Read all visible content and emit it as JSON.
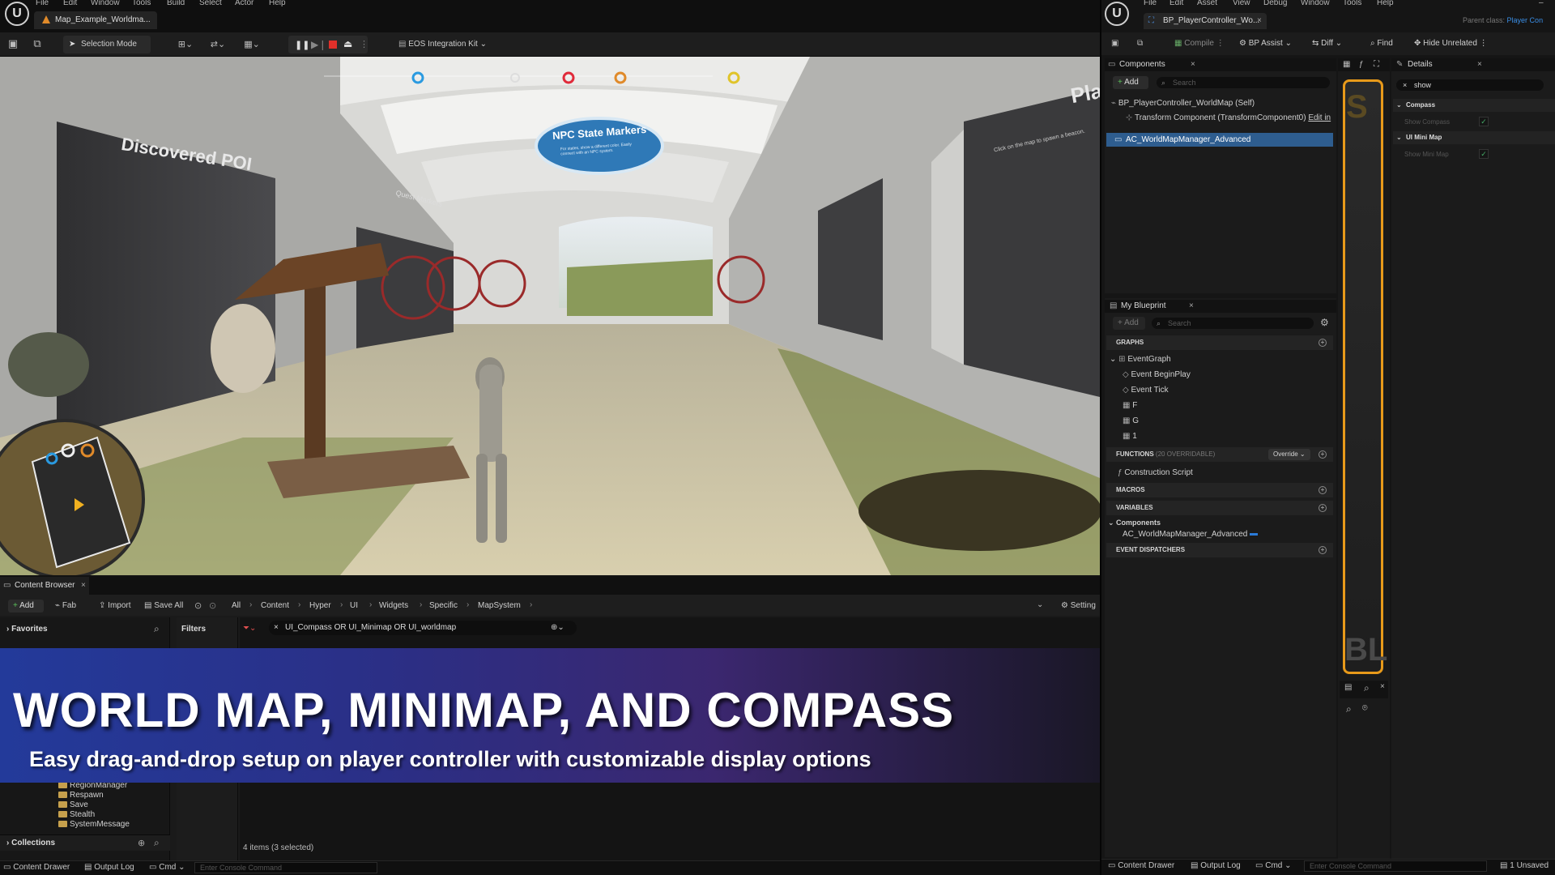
{
  "left_menu": [
    "File",
    "Edit",
    "Window",
    "Tools",
    "Build",
    "Select",
    "Actor",
    "Help"
  ],
  "left_doc_tab": "Map_Example_Worldma...",
  "left_toolbar": {
    "selection_mode": "Selection Mode",
    "eos": "EOS Integration Kit"
  },
  "viewport": {
    "sign_poi": "Discovered POI",
    "sign_npc_title": "NPC State Markers",
    "sign_npc_sub": "For states, show a different color. Easily connect with an NPC system.",
    "sign_quest": "Quest Markers",
    "sign_right": "Pla",
    "sign_right_sub": "Click on the map to spawn a beacon."
  },
  "content_browser": {
    "tab": "Content Browser",
    "add": "Add",
    "fab": "Fab",
    "import": "Import",
    "save_all": "Save All",
    "breadcrumb": [
      "All",
      "Content",
      "Hyper",
      "UI",
      "Widgets",
      "Specific",
      "MapSystem"
    ],
    "settings": "Setting",
    "favorites": "Favorites",
    "filters": "Filters",
    "filter_query": "UI_Compass OR UI_Minimap OR UI_worldmap",
    "folders": [
      "RegionManager",
      "Respawn",
      "Save",
      "Stealth",
      "SystemMessage"
    ],
    "collections": "Collections",
    "item_count": "4 items (3 selected)"
  },
  "status_left": {
    "drawer": "Content Drawer",
    "output": "Output Log",
    "cmd": "Cmd",
    "console_placeholder": "Enter Console Command"
  },
  "banner": {
    "title": "WORLD MAP, MINIMAP, AND COMPASS",
    "subtitle": "Easy drag-and-drop setup on player controller with customizable display options"
  },
  "right_menu": [
    "File",
    "Edit",
    "Asset",
    "View",
    "Debug",
    "Window",
    "Tools",
    "Help"
  ],
  "right_doc_tab": "BP_PlayerController_Wo...",
  "parent_class_label": "Parent class:",
  "parent_class_value": "Player Con",
  "right_toolbar": {
    "compile": "Compile",
    "bp_assist": "BP Assist",
    "diff": "Diff",
    "find": "Find",
    "hide_unrelated": "Hide Unrelated"
  },
  "components": {
    "title": "Components",
    "add": "Add",
    "search": "Search",
    "self": "BP_PlayerController_WorldMap (Self)",
    "transform": "Transform Component (TransformComponent0)",
    "edit_in": "Edit in",
    "selected": "AC_WorldMapManager_Advanced"
  },
  "my_blueprint": {
    "title": "My Blueprint",
    "add": "Add",
    "search": "Search",
    "graphs": "GRAPHS",
    "event_graph": "EventGraph",
    "events": [
      "Event BeginPlay",
      "Event Tick",
      "F",
      "G",
      "1"
    ],
    "functions": "FUNCTIONS",
    "functions_count": "(20 OVERRIDABLE)",
    "override": "Override",
    "construction": "Construction Script",
    "macros": "MACROS",
    "variables": "VARIABLES",
    "components_cat": "Components",
    "var_item": "AC_WorldMapManager_Advanced",
    "dispatchers": "EVENT DISPATCHERS"
  },
  "graph_letters": {
    "top": "S",
    "bottom": "BL"
  },
  "details": {
    "title": "Details",
    "search_value": "show",
    "compass": "Compass",
    "show_compass": "Show Compass",
    "minimap": "UI Mini Map",
    "show_minimap": "Show Mini Map"
  },
  "status_right": {
    "drawer": "Content Drawer",
    "output": "Output Log",
    "cmd": "Cmd",
    "console_placeholder": "Enter Console Command",
    "unsaved": "1 Unsaved"
  }
}
